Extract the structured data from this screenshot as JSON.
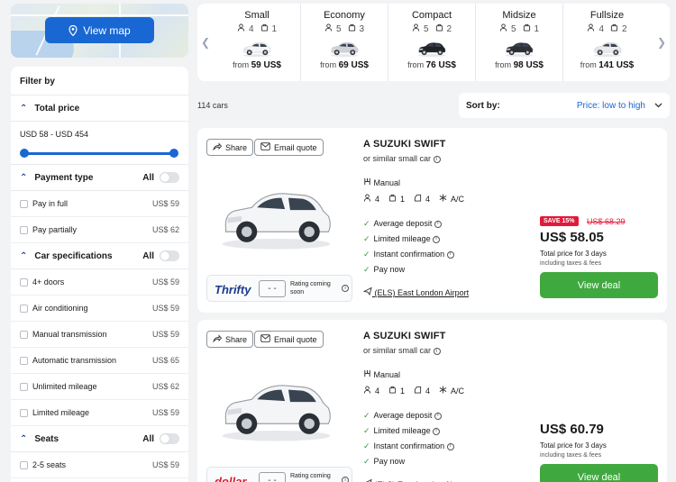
{
  "map": {
    "button_label": "View map"
  },
  "categories": [
    {
      "name": "Small",
      "passengers": "4",
      "bags": "1",
      "from_label": "from",
      "price": "59 US$"
    },
    {
      "name": "Economy",
      "passengers": "5",
      "bags": "3",
      "from_label": "from",
      "price": "69 US$"
    },
    {
      "name": "Compact",
      "passengers": "5",
      "bags": "2",
      "from_label": "from",
      "price": "76 US$"
    },
    {
      "name": "Midsize",
      "passengers": "5",
      "bags": "1",
      "from_label": "from",
      "price": "98 US$"
    },
    {
      "name": "Fullsize",
      "passengers": "4",
      "bags": "2",
      "from_label": "from",
      "price": "141 US$"
    }
  ],
  "filter": {
    "title": "Filter by",
    "total_price": {
      "label": "Total price",
      "range": "USD 58 - USD 454"
    },
    "payment": {
      "label": "Payment type",
      "all": "All",
      "items": [
        {
          "label": "Pay in full",
          "price": "US$ 59"
        },
        {
          "label": "Pay partially",
          "price": "US$ 62"
        }
      ]
    },
    "specs": {
      "label": "Car specifications",
      "all": "All",
      "items": [
        {
          "label": "4+ doors",
          "price": "US$ 59"
        },
        {
          "label": "Air conditioning",
          "price": "US$ 59"
        },
        {
          "label": "Manual transmission",
          "price": "US$ 59"
        },
        {
          "label": "Automatic transmission",
          "price": "US$ 65"
        },
        {
          "label": "Unlimited mileage",
          "price": "US$ 62"
        },
        {
          "label": "Limited mileage",
          "price": "US$ 59"
        }
      ]
    },
    "seats": {
      "label": "Seats",
      "all": "All",
      "items": [
        {
          "label": "2-5 seats",
          "price": "US$ 59"
        }
      ]
    }
  },
  "results": {
    "count": "114 cars",
    "sort_label": "Sort by:",
    "sort_value": "Price: low to high"
  },
  "cards": [
    {
      "share": "Share",
      "email": "Email quote",
      "title": "A SUZUKI SWIFT",
      "subtitle": "or similar small car",
      "transmission": "Manual",
      "passengers": "4",
      "bags": "1",
      "doors": "4",
      "ac": "A/C",
      "features": [
        "Average deposit",
        "Limited mileage",
        "Instant confirmation",
        "Pay now"
      ],
      "location": "(ELS) East London Airport",
      "supplier": "Thrifty",
      "rating": "- -",
      "rating_text_1": "Rating coming",
      "rating_text_2": "soon",
      "save_badge": "SAVE 15%",
      "old_price": "US$ 68.29",
      "price": "US$ 58.05",
      "total_label": "Total price for 3 days",
      "incl": "including taxes & fees",
      "deal": "View deal"
    },
    {
      "share": "Share",
      "email": "Email quote",
      "title": "A SUZUKI SWIFT",
      "subtitle": "or similar small car",
      "transmission": "Manual",
      "passengers": "4",
      "bags": "1",
      "doors": "4",
      "ac": "A/C",
      "features": [
        "Average deposit",
        "Limited mileage",
        "Instant confirmation",
        "Pay now"
      ],
      "location": "(ELS) East London Airport",
      "supplier": "dollar.",
      "rating": "- -",
      "rating_text_1": "Rating coming",
      "rating_text_2": "soon",
      "price": "US$ 60.79",
      "total_label": "Total price for 3 days",
      "incl": "including taxes & fees",
      "deal": "View deal"
    }
  ],
  "colors": {
    "accent": "#1967d2",
    "deal": "#3fa93f",
    "save": "#e3193a"
  }
}
